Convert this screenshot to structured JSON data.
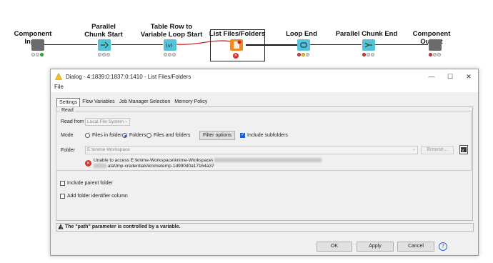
{
  "workflow": {
    "nodes": [
      {
        "label": "Component Input",
        "icon": "component-input-icon",
        "color": "#6b6b6b",
        "status": [
          "#e8e8e8",
          "#e8e8e8",
          "#2fb52f"
        ]
      },
      {
        "label": "Parallel\nChunk Start",
        "icon": "parallel-chunk-start-icon",
        "color": "#55c2d8",
        "status": [
          "#e8e8e8",
          "#e8e8e8",
          "#e8e8e8"
        ]
      },
      {
        "label": "Table Row to\nVariable Loop Start",
        "icon": "table-row-variable-loop-icon",
        "color": "#55c2d8",
        "status": [
          "#e8e8e8",
          "#e8e8e8",
          "#e8e8e8"
        ]
      },
      {
        "label": "List Files/Folders",
        "icon": "list-files-folders-icon",
        "color": "#f08a1e",
        "status": [
          "error"
        ]
      },
      {
        "label": "Loop End",
        "icon": "loop-end-icon",
        "color": "#55c2d8",
        "status": [
          "#e04040",
          "#f0c020",
          "#e8e8e8"
        ]
      },
      {
        "label": "Parallel Chunk End",
        "icon": "parallel-chunk-end-icon",
        "color": "#55c2d8",
        "status": [
          "#e04040",
          "#e8e8e8",
          "#e8e8e8"
        ]
      },
      {
        "label": "Component Output",
        "icon": "component-output-icon",
        "color": "#6b6b6b",
        "status": [
          "#e04040",
          "#e8e8e8",
          "#e8e8e8"
        ]
      }
    ]
  },
  "dialog": {
    "title": "Dialog - 4:1839:0:1837:0:1410 - List Files/Folders",
    "menu": "File",
    "tabs": [
      "Settings",
      "Flow Variables",
      "Job Manager Selection",
      "Memory Policy"
    ],
    "read_legend": "Read",
    "read_from_label": "Read from",
    "read_from_value": "Local File System",
    "mode_label": "Mode",
    "mode_options": [
      "Files in folder",
      "Folders",
      "Files and folders"
    ],
    "mode_selected": "Folders",
    "filter_button": "Filter options",
    "include_subfolders": "Include subfolders",
    "folder_label": "Folder",
    "folder_value": "E:\\knime-Workspace",
    "browse_button": "Browse...",
    "error_line1": "Unable to access E:\\knime-Workspace\\knime-Workspace\\",
    "error_line2": "ata\\tmp-credentials\\knimetemp-1d990d0a17164a37",
    "include_parent_folder": "Include parent folder",
    "add_folder_identifier": "Add folder identifier column",
    "warning": "The \"path\" parameter is controlled by a variable.",
    "ok_button": "OK",
    "apply_button": "Apply",
    "cancel_button": "Cancel"
  },
  "colors": {
    "connection_highlight": "#d02424",
    "accent": "#1a5fd0",
    "error": "#d9302c"
  }
}
